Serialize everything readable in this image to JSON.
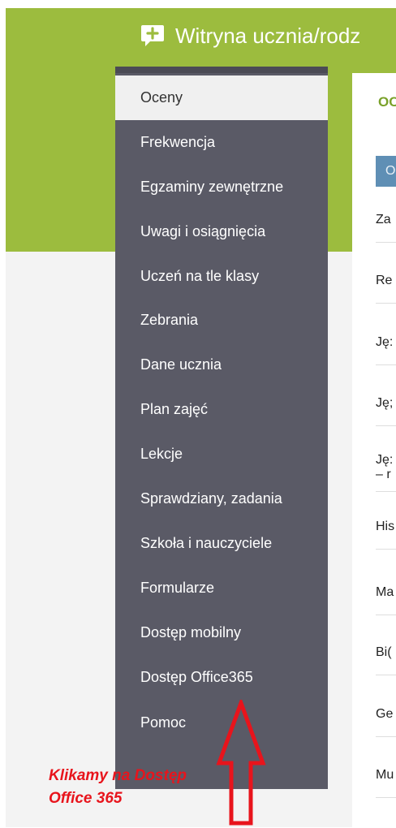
{
  "header": {
    "title": "Witryna ucznia/rodz"
  },
  "sidebar": {
    "items": [
      {
        "label": "Oceny",
        "active": true
      },
      {
        "label": "Frekwencja"
      },
      {
        "label": "Egzaminy zewnętrzne"
      },
      {
        "label": "Uwagi i osiągnięcia"
      },
      {
        "label": "Uczeń na tle klasy"
      },
      {
        "label": "Zebrania"
      },
      {
        "label": "Dane ucznia"
      },
      {
        "label": "Plan zajęć"
      },
      {
        "label": "Lekcje"
      },
      {
        "label": "Sprawdziany, zadania"
      },
      {
        "label": "Szkoła i nauczyciele"
      },
      {
        "label": "Formularze"
      },
      {
        "label": "Dostęp mobilny"
      },
      {
        "label": "Dostęp Office365"
      },
      {
        "label": "Pomoc"
      }
    ]
  },
  "content": {
    "heading": "OC",
    "button_label": "O",
    "subjects": [
      {
        "text": "Za"
      },
      {
        "text": "Re"
      },
      {
        "text": "Ję:"
      },
      {
        "text": "Ję;"
      },
      {
        "text": "Ję:",
        "line2": "– r"
      },
      {
        "text": "His"
      },
      {
        "text": "Ma"
      },
      {
        "text": "Bi("
      },
      {
        "text": "Ge"
      },
      {
        "text": "Mu"
      }
    ]
  },
  "annotation": {
    "line1": "Klikamy na Dostęp",
    "line2": "Office 365"
  },
  "colors": {
    "header_green": "#9cbc3e",
    "sidebar": "#5a5a66",
    "annotation_red": "#e8141c"
  }
}
